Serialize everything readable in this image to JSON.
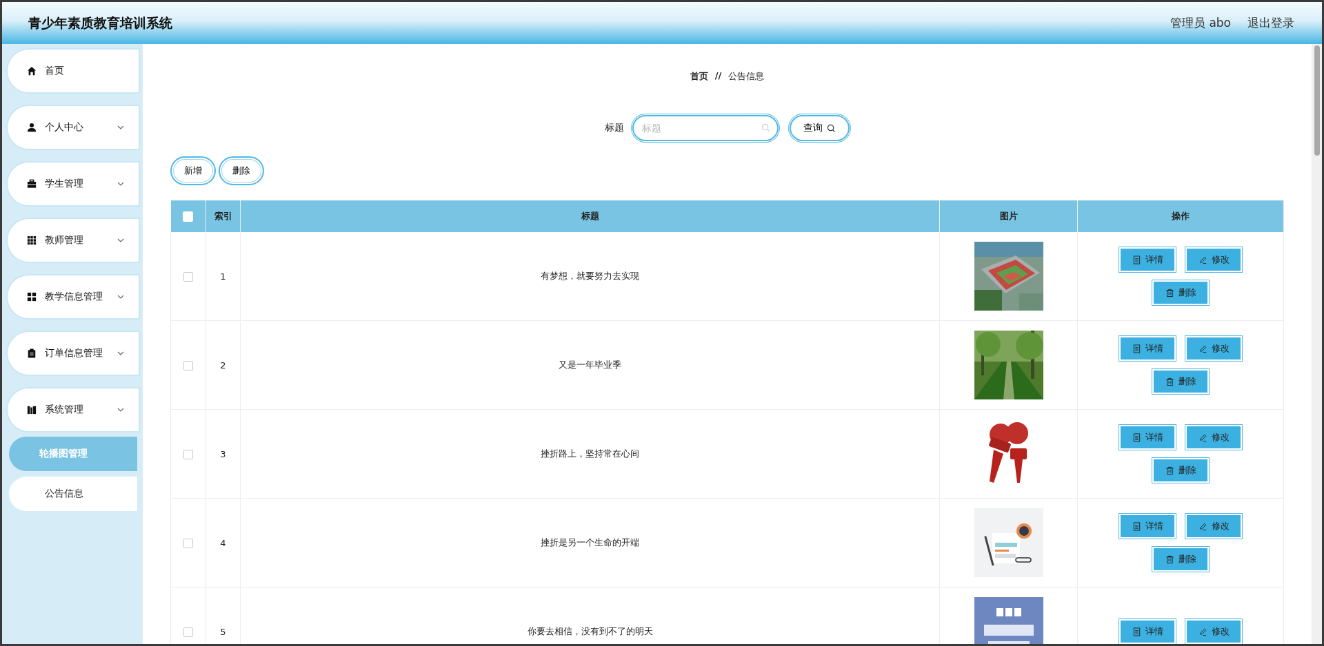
{
  "header": {
    "title": "青少年素质教育培训系统",
    "user": "管理员 abo",
    "logout": "退出登录"
  },
  "sidebar": {
    "items": [
      {
        "label": "首页",
        "kind": "link"
      },
      {
        "label": "个人中心",
        "kind": "menu"
      },
      {
        "label": "学生管理",
        "kind": "menu"
      },
      {
        "label": "教师管理",
        "kind": "menu"
      },
      {
        "label": "教学信息管理",
        "kind": "menu"
      },
      {
        "label": "订单信息管理",
        "kind": "menu"
      },
      {
        "label": "系统管理",
        "kind": "menu",
        "children": [
          {
            "label": "轮播图管理",
            "selected": true
          },
          {
            "label": "公告信息",
            "selected": false
          }
        ]
      }
    ]
  },
  "breadcrumb": {
    "items": [
      "首页",
      "公告信息"
    ],
    "separator": "//"
  },
  "search": {
    "label": "标题",
    "placeholder": "标题",
    "button": "查询"
  },
  "toolbar": [
    "新增",
    "删除"
  ],
  "table": {
    "select_all": {
      "checked": false
    },
    "columns": [
      "索引",
      "标题",
      "图片",
      "操作"
    ],
    "rows": [
      {
        "checked": false,
        "index": "1",
        "title": "有梦想，就要努力去实现",
        "actions": [
          "详情",
          "修改",
          "删除"
        ]
      },
      {
        "checked": false,
        "index": "2",
        "title": "又是一年毕业季",
        "actions": [
          "详情",
          "修改",
          "删除"
        ]
      },
      {
        "checked": false,
        "index": "3",
        "title": "挫折路上，坚持常在心间",
        "actions": [
          "详情",
          "修改",
          "删除"
        ]
      },
      {
        "checked": false,
        "index": "4",
        "title": "挫折是另一个生命的开端",
        "actions": [
          "详情",
          "修改",
          "删除"
        ]
      },
      {
        "checked": false,
        "index": "5",
        "title": "你要去相信，没有到不了的明天",
        "actions": [
          "详情",
          "修改"
        ]
      }
    ]
  }
}
